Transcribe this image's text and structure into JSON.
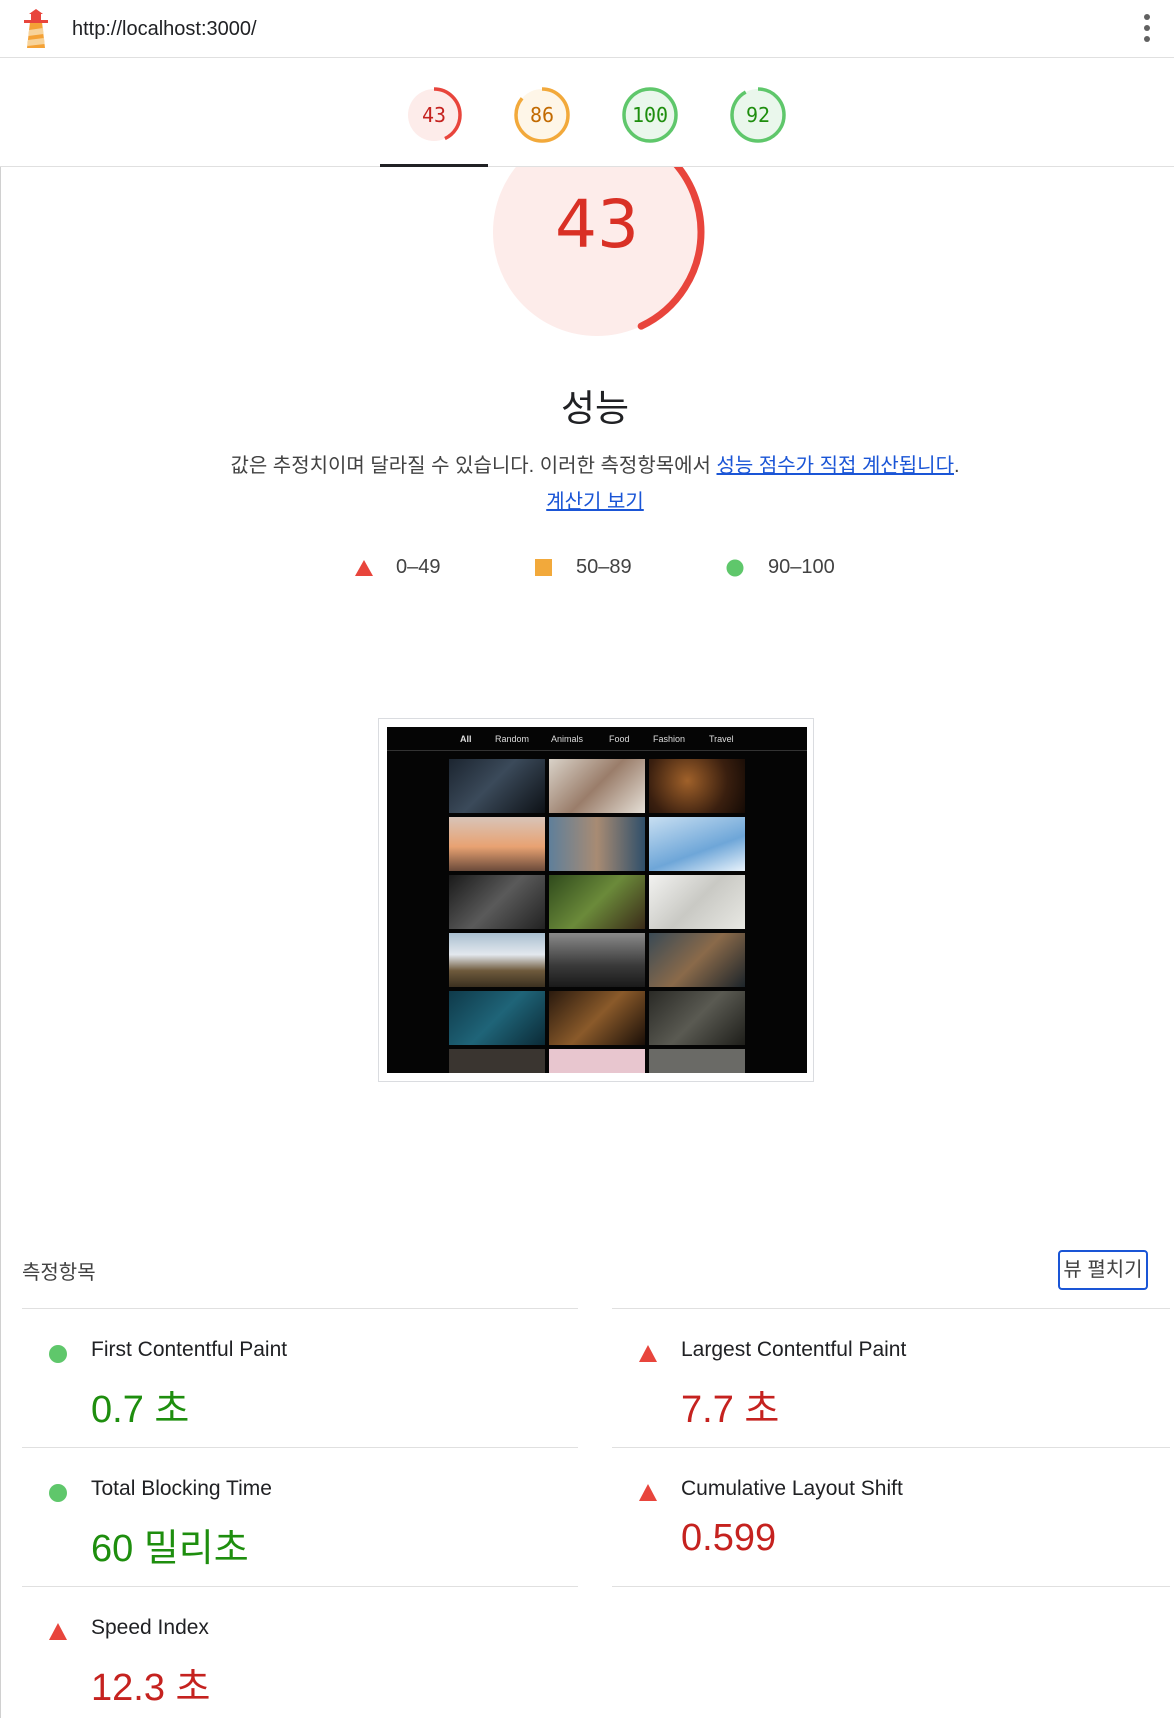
{
  "browser": {
    "url": "http://localhost:3000/",
    "logo_icon": "lighthouse-icon",
    "menu_icon": "more-vert-icon"
  },
  "category_tabs": [
    {
      "score": "43",
      "level": "fail",
      "fraction": 0.43,
      "color": "#e8453c"
    },
    {
      "score": "86",
      "level": "average",
      "fraction": 0.86,
      "color": "#f2a93b"
    },
    {
      "score": "100",
      "level": "pass",
      "fraction": 1.0,
      "color": "#5fc76b"
    },
    {
      "score": "92",
      "level": "pass",
      "fraction": 0.92,
      "color": "#5fc76b"
    }
  ],
  "performance": {
    "score": "43",
    "fraction": 0.43,
    "title": "성능",
    "description_text": "값은 추정치이며 달라질 수 있습니다. 이러한 측정항목에서 ",
    "description_link": "성능 점수가 직접 계산됩니다",
    "description_sep": ". ",
    "calculator_link": "계산기 보기"
  },
  "legend": [
    {
      "shape": "triangle",
      "label": "0–49",
      "color": "#e8453c"
    },
    {
      "shape": "square",
      "label": "50–89",
      "color": "#f2a93b"
    },
    {
      "shape": "circle",
      "label": "90–100",
      "color": "#5fc76b"
    }
  ],
  "screenshot": {
    "nav_items": [
      "All",
      "Random",
      "Animals",
      "Food",
      "Fashion",
      "Travel"
    ]
  },
  "metrics_section": {
    "title": "측정항목",
    "expand_label": "뷰 펼치기"
  },
  "metrics": [
    {
      "name": "First Contentful Paint",
      "value": "0.7 초",
      "rating": "good"
    },
    {
      "name": "Largest Contentful Paint",
      "value": "7.7 초",
      "rating": "bad"
    },
    {
      "name": "Total Blocking Time",
      "value": "60 밀리초",
      "rating": "good"
    },
    {
      "name": "Cumulative Layout Shift",
      "value": "0.599",
      "rating": "bad"
    },
    {
      "name": "Speed Index",
      "value": "12.3 초",
      "rating": "bad"
    }
  ],
  "colors": {
    "fail": "#e8453c",
    "average": "#f2a93b",
    "pass": "#5fc76b",
    "fail_bg": "#fdecea",
    "average_bg": "#fef6e8",
    "pass_bg": "#eaf7ec",
    "link": "#1a55d6"
  }
}
